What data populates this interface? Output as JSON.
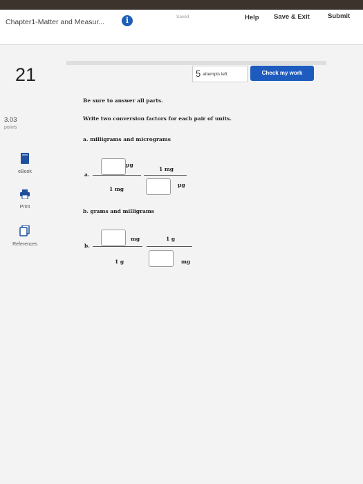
{
  "header": {
    "title": "Chapter1-Matter and Measur...",
    "saved": "Saved",
    "help": "Help",
    "save_exit": "Save & Exit",
    "submit": "Submit"
  },
  "question": {
    "number": "21",
    "points": "3.03",
    "points_label": "points",
    "attempts_count": "5",
    "attempts_label": "attempts left",
    "check_button": "Check my work"
  },
  "sidebar": {
    "items": [
      {
        "label": "eBook",
        "icon": "book-icon"
      },
      {
        "label": "Print",
        "icon": "printer-icon"
      },
      {
        "label": "References",
        "icon": "references-icon"
      }
    ]
  },
  "content": {
    "intro": "Be sure to answer all parts.",
    "instruction": "Write two conversion factors for each pair of units.",
    "part_a_title": "a. milligrams and micrograms",
    "part_a_letter": "a.",
    "part_a_unit_mu": "µg",
    "part_a_f1_den": "1 mg",
    "part_a_f2_num": "1 mg",
    "part_b_title": "b. grams and milligrams",
    "part_b_letter": "b.",
    "part_b_unit_mg": "mg",
    "part_b_f1_den": "1 g",
    "part_b_f2_num": "1 g"
  }
}
